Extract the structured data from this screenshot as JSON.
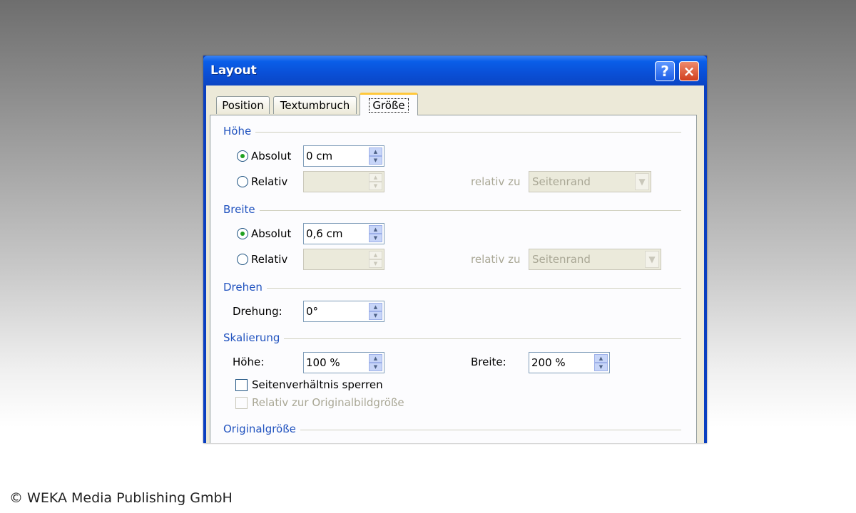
{
  "dialog": {
    "title": "Layout",
    "help_label": "?",
    "close_label": "×",
    "tabs": [
      {
        "label": "Position",
        "active": false
      },
      {
        "label": "Textumbruch",
        "active": false
      },
      {
        "label": "Größe",
        "active": true
      }
    ]
  },
  "hoehe": {
    "group_label": "Höhe",
    "absolut_label": "Absolut",
    "absolut_value": "0 cm",
    "absolut_checked": true,
    "relativ_label": "Relativ",
    "relativ_value": "",
    "relativ_zu_label": "relativ zu",
    "relativ_zu_value": "Seitenrand"
  },
  "breite": {
    "group_label": "Breite",
    "absolut_label": "Absolut",
    "absolut_value": "0,6 cm",
    "absolut_checked": true,
    "relativ_label": "Relativ",
    "relativ_value": "",
    "relativ_zu_label": "relativ zu",
    "relativ_zu_value": "Seitenrand"
  },
  "drehen": {
    "group_label": "Drehen",
    "drehung_label": "Drehung:",
    "drehung_value": "0°"
  },
  "skalierung": {
    "group_label": "Skalierung",
    "hoehe_label": "Höhe:",
    "hoehe_value": "100 %",
    "breite_label": "Breite:",
    "breite_value": "200 %",
    "lock_label": "Seitenverhältnis sperren",
    "lock_checked": false,
    "relative_label": "Relativ zur Originalbildgröße",
    "relative_checked": false
  },
  "originalgroesse": {
    "group_label": "Originalgröße"
  },
  "footer": {
    "copyright": "© WEKA Media Publishing GmbH"
  },
  "colors": {
    "title_bar": "#0a4fd6",
    "group_label": "#2153bf",
    "active_tab_accent": "#ffc83c",
    "radio_dot": "#21a121"
  }
}
